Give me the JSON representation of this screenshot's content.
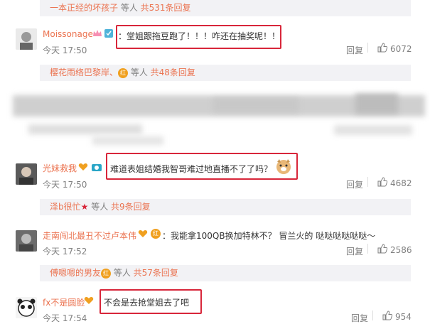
{
  "comments": [
    {
      "user": "Moissonage",
      "text": "：堂姐跟拖豆跑了！！！咋还在抽奖呢！！",
      "time": "今天 17:50",
      "reply": "回复",
      "likes": "6072"
    },
    {
      "user": "光妹救我",
      "text": "难道表姐结婚我智哥难过地直播不了了吗？",
      "time": "今天 17:50",
      "reply": "回复",
      "likes": "4682"
    },
    {
      "user": "走南闯北最丑不过卢本伟",
      "text": "：我能拿100QB换加特林不？ 冒兰火的 哒哒哒哒哒哒～",
      "time": "今天 17:52",
      "reply": "回复",
      "likes": "2586"
    },
    {
      "user": "fx不是圆脸",
      "text": "不会是去抢堂姐去了吧",
      "time": "今天 17:54",
      "reply": "回复",
      "likes": "954"
    }
  ],
  "subreplies": [
    {
      "name": "一本正经的坏孩子",
      "suffix": " 等人 ",
      "count": "共531条回复"
    },
    {
      "name": "樱花雨络巴黎岸、",
      "suffix": " 等人 ",
      "count": "共48条回复"
    },
    {
      "name": "泽b很忙",
      "suffix": " 等人 ",
      "count": "共9条回复"
    },
    {
      "name": "傅嗯嗯的男友",
      "suffix": " 等人 ",
      "count": "共57条回复"
    }
  ],
  "badges": {
    "vip_label": "红"
  },
  "colors": {
    "username": "#eb7350",
    "highlight_box": "#d8263a",
    "subreply_bg": "#f2f2f5"
  }
}
